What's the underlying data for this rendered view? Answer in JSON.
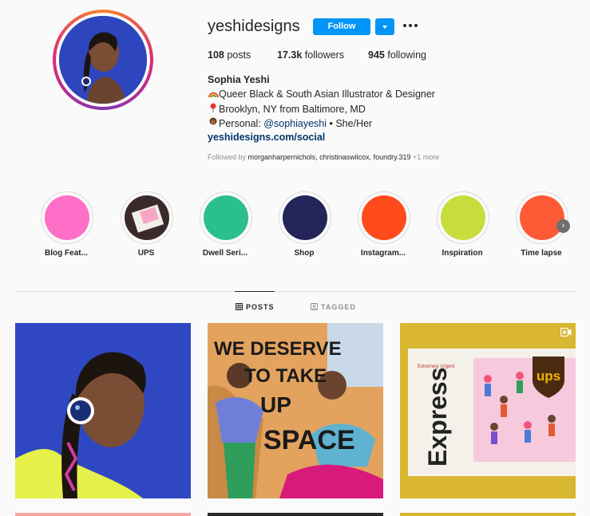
{
  "profile": {
    "username": "yeshidesigns",
    "follow_label": "Follow",
    "stats": [
      {
        "count": "108",
        "label": "posts"
      },
      {
        "count": "17.3k",
        "label": "followers"
      },
      {
        "count": "945",
        "label": "following"
      }
    ],
    "full_name": "Sophia Yeshi",
    "bio": {
      "line1": "Queer Black & South Asian Illustrator & Designer",
      "line2": "Brooklyn, NY from Baltimore, MD",
      "line3_prefix": "Personal:",
      "line3_mention": "@sophiayeshi",
      "line3_suffix": "• She/Her"
    },
    "website": "yeshidesigns.com/social",
    "followed_by": {
      "prefix": "Followed by",
      "names": "morganharpernichols, christinaswilcox, foundry.319",
      "more": "+1 more"
    }
  },
  "highlights": [
    {
      "label": "Blog Feat...",
      "color": "#ff6ec7"
    },
    {
      "label": "UPS",
      "color": "#3a2a2a"
    },
    {
      "label": "Dwell Seri...",
      "color": "#2bbf8c"
    },
    {
      "label": "Shop",
      "color": "#232457"
    },
    {
      "label": "Instagram...",
      "color": "#ff4a1c"
    },
    {
      "label": "Inspiration",
      "color": "#c8dc3c"
    },
    {
      "label": "Time lapse",
      "color": "#ff5a36"
    }
  ],
  "tabs": {
    "posts": "POSTS",
    "tagged": "TAGGED"
  },
  "posts": {
    "post2_text_lines": [
      "WE DESERVE",
      "TO TAKE",
      "UP",
      "SPACE"
    ],
    "post3_box_text": "Express",
    "post3_logo_text": "ups",
    "post3_small_text": "Extremely Urgent"
  },
  "colors": {
    "accent": "#0095f6",
    "link": "#00376b"
  }
}
